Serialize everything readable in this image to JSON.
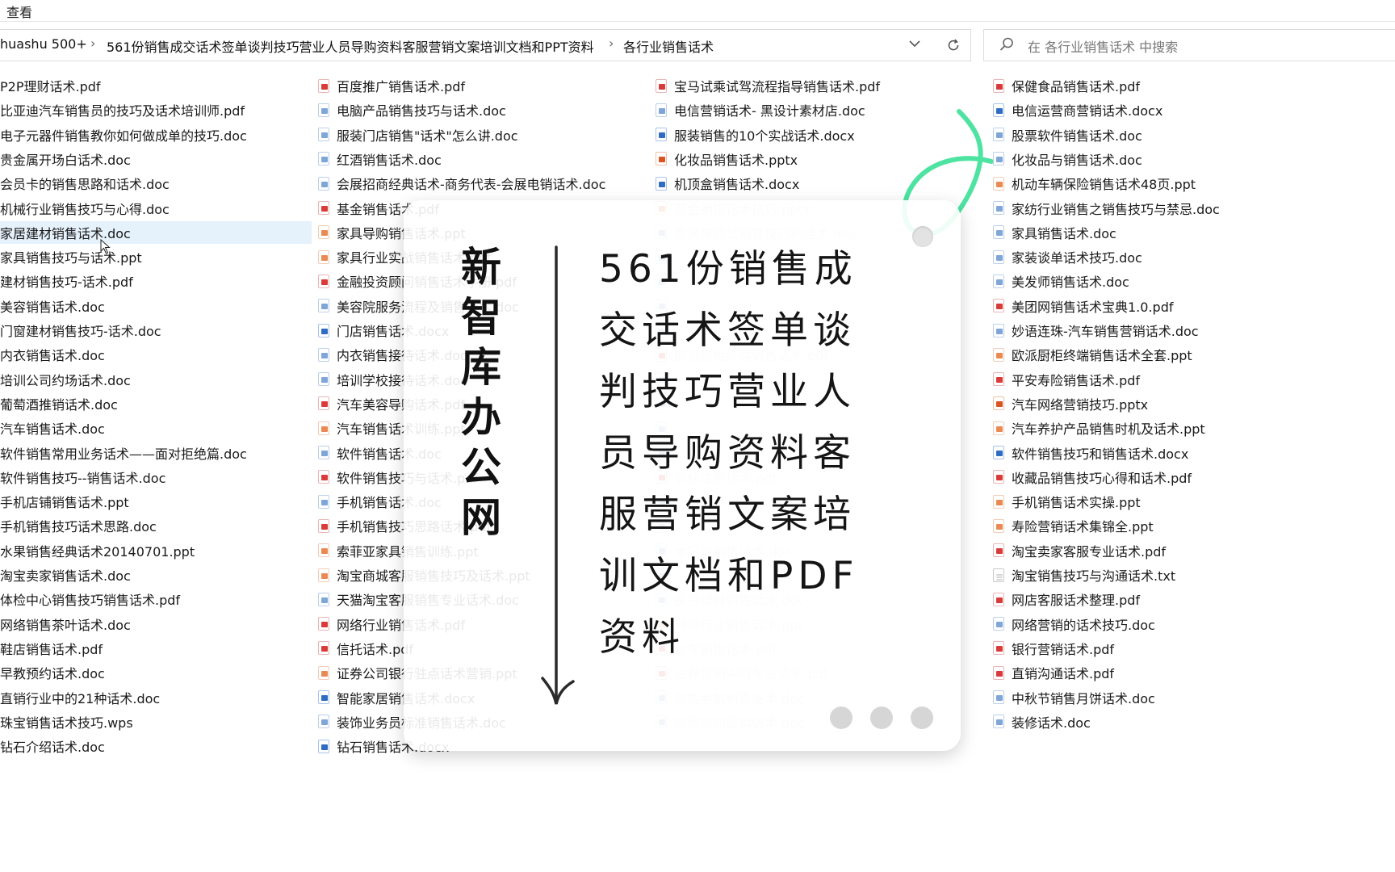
{
  "menu": {
    "view_label": "查看"
  },
  "breadcrumb": {
    "items": [
      "huashu 500+",
      "561份销售成交话术签单谈判技巧营业人员导购资料客服营销文案培训文档和PPT资料",
      "各行业销售话术"
    ]
  },
  "search": {
    "placeholder": "在 各行业销售话术 中搜索"
  },
  "columns": [
    {
      "files": [
        {
          "name": "P2P理财话术.pdf",
          "type": "none"
        },
        {
          "name": "比亚迪汽车销售员的技巧及话术培训师.pdf",
          "type": "none"
        },
        {
          "name": "电子元器件销售教你如何做成单的技巧.doc",
          "type": "none"
        },
        {
          "name": "贵金属开场白话术.doc",
          "type": "none"
        },
        {
          "name": "会员卡的销售思路和话术.doc",
          "type": "none"
        },
        {
          "name": "机械行业销售技巧与心得.doc",
          "type": "none"
        },
        {
          "name": "家居建材销售话术.doc",
          "type": "none",
          "selected": true
        },
        {
          "name": "家具销售技巧与话术.ppt",
          "type": "none"
        },
        {
          "name": "建材销售技巧-话术.pdf",
          "type": "none"
        },
        {
          "name": "美容销售话术.doc",
          "type": "none"
        },
        {
          "name": "门窗建材销售技巧-话术.doc",
          "type": "none"
        },
        {
          "name": "内衣销售话术.doc",
          "type": "none"
        },
        {
          "name": "培训公司约场话术.doc",
          "type": "none"
        },
        {
          "name": "葡萄酒推销话术.doc",
          "type": "none"
        },
        {
          "name": "汽车销售话术.doc",
          "type": "none"
        },
        {
          "name": "软件销售常用业务话术——面对拒绝篇.doc",
          "type": "none"
        },
        {
          "name": "软件销售技巧--销售话术.doc",
          "type": "none"
        },
        {
          "name": "手机店铺销售话术.ppt",
          "type": "none"
        },
        {
          "name": "手机销售技巧话术思路.doc",
          "type": "none"
        },
        {
          "name": "水果销售经典话术20140701.ppt",
          "type": "none"
        },
        {
          "name": "淘宝卖家销售话术.doc",
          "type": "none"
        },
        {
          "name": "体检中心销售技巧销售话术.pdf",
          "type": "none"
        },
        {
          "name": "网络销售茶叶话术.doc",
          "type": "none"
        },
        {
          "name": "鞋店销售话术.pdf",
          "type": "none"
        },
        {
          "name": "早教预约话术.doc",
          "type": "none"
        },
        {
          "name": "直销行业中的21种话术.doc",
          "type": "none"
        },
        {
          "name": "珠宝销售话术技巧.wps",
          "type": "none"
        },
        {
          "name": "钻石介绍话术.doc",
          "type": "none"
        }
      ]
    },
    {
      "files": [
        {
          "name": "百度推广销售话术.pdf",
          "type": "pdf"
        },
        {
          "name": "电脑产品销售技巧与话术.doc",
          "type": "doc"
        },
        {
          "name": "服装门店销售\"话术\"怎么讲.doc",
          "type": "doc"
        },
        {
          "name": "红酒销售话术.doc",
          "type": "doc"
        },
        {
          "name": "会展招商经典话术-商务代表-会展电销话术.doc",
          "type": "doc"
        },
        {
          "name": "基金销售话术.pdf",
          "type": "pdf"
        },
        {
          "name": "家具导购销售话术.ppt",
          "type": "ppt"
        },
        {
          "name": "家具行业实战销售话术.ppt",
          "type": "ppt"
        },
        {
          "name": "金融投资顾问销售话术手册.pdf",
          "type": "pdf"
        },
        {
          "name": "美容院服务流程及销售话术.doc",
          "type": "doc"
        },
        {
          "name": "门店销售话术.docx",
          "type": "docx"
        },
        {
          "name": "内衣销售接待话术.doc",
          "type": "doc"
        },
        {
          "name": "培训学校接待话术.doc",
          "type": "doc"
        },
        {
          "name": "汽车美容导购话术.pdf",
          "type": "pdf"
        },
        {
          "name": "汽车销售话术训练.ppt",
          "type": "ppt"
        },
        {
          "name": "软件销售话术.doc",
          "type": "doc"
        },
        {
          "name": "软件销售技巧与话术.pdf",
          "type": "pdf"
        },
        {
          "name": "手机销售话术.doc",
          "type": "doc"
        },
        {
          "name": "手机销售技巧思路话术.pdf",
          "type": "pdf"
        },
        {
          "name": "索菲亚家具销售训练.ppt",
          "type": "ppt"
        },
        {
          "name": "淘宝商城客服销售技巧及话术.ppt",
          "type": "ppt"
        },
        {
          "name": "天猫淘宝客服销售专业话术.doc",
          "type": "doc"
        },
        {
          "name": "网络行业销售话术.pdf",
          "type": "pdf"
        },
        {
          "name": "信托话术.pdf",
          "type": "pdf"
        },
        {
          "name": "证券公司银行驻点话术营销.ppt",
          "type": "ppt"
        },
        {
          "name": "智能家居销售话术.docx",
          "type": "docx"
        },
        {
          "name": "装饰业务员标准销售话术.doc",
          "type": "doc"
        },
        {
          "name": "钻石销售话术.docx",
          "type": "docx"
        }
      ]
    },
    {
      "files": [
        {
          "name": "宝马试乘试驾流程指导销售话术.pdf",
          "type": "pdf"
        },
        {
          "name": "电信营销话术- 黑设计素材店.doc",
          "type": "doc"
        },
        {
          "name": "服装销售的10个实战话术.docx",
          "type": "docx"
        },
        {
          "name": "化妆品销售话术.pptx",
          "type": "pptx"
        },
        {
          "name": "机顶盒销售话术.docx",
          "type": "docx"
        },
        {
          "name": "基金销售话术技巧.pptx",
          "type": "pptx"
        },
        {
          "name": "家具导购员销售技巧和话术.doc",
          "type": "doc"
        },
        {
          "name": "",
          "type": "doc"
        },
        {
          "name": "",
          "type": "doc"
        },
        {
          "name": "",
          "type": "doc"
        },
        {
          "name": "",
          "type": "doc"
        },
        {
          "name": "欧派厨柜终端销售话术.pdf",
          "type": "pdf"
        },
        {
          "name": "",
          "type": "doc"
        },
        {
          "name": "",
          "type": "doc"
        },
        {
          "name": "",
          "type": "doc"
        },
        {
          "name": "",
          "type": "doc"
        },
        {
          "name": "商标注册话术.pdf",
          "type": "pdf"
        },
        {
          "name": "",
          "type": "doc"
        },
        {
          "name": "",
          "type": "doc"
        },
        {
          "name": "太阳能销售话术.doc",
          "type": "doc"
        },
        {
          "name": "",
          "type": "doc"
        },
        {
          "name": "投资理财销售话术.doc",
          "type": "doc"
        },
        {
          "name": "网络行业销售话术.ppt",
          "type": "ppt"
        },
        {
          "name": "新车销售话术.pdf",
          "type": "pdf"
        },
        {
          "name": "证券营销中的专业话术.pdf",
          "type": "pdf"
        },
        {
          "name": "智能手机销售话术.doc",
          "type": "doc"
        },
        {
          "name": "装修公司营销话术.doc",
          "type": "doc"
        }
      ]
    },
    {
      "files": [
        {
          "name": "保健食品销售话术.pdf",
          "type": "pdf"
        },
        {
          "name": "电信运营商营销话术.docx",
          "type": "docx"
        },
        {
          "name": "股票软件销售话术.doc",
          "type": "doc"
        },
        {
          "name": "化妆品与销售话术.doc",
          "type": "doc"
        },
        {
          "name": "机动车辆保险销售话术48页.ppt",
          "type": "ppt"
        },
        {
          "name": "家纺行业销售之销售技巧与禁忌.doc",
          "type": "doc"
        },
        {
          "name": "家具销售话术.doc",
          "type": "doc"
        },
        {
          "name": "家装谈单话术技巧.doc",
          "type": "doc"
        },
        {
          "name": "美发师销售话术.doc",
          "type": "doc"
        },
        {
          "name": "美团网销售话术宝典1.0.pdf",
          "type": "pdf"
        },
        {
          "name": "妙语连珠-汽车销售营销话术.doc",
          "type": "doc"
        },
        {
          "name": "欧派厨柜终端销售话术全套.ppt",
          "type": "ppt"
        },
        {
          "name": "平安寿险销售话术.pdf",
          "type": "pdf"
        },
        {
          "name": "汽车网络营销技巧.pptx",
          "type": "pptx"
        },
        {
          "name": "汽车养护产品销售时机及话术.ppt",
          "type": "ppt"
        },
        {
          "name": "软件销售技巧和销售话术.docx",
          "type": "docx"
        },
        {
          "name": "收藏品销售技巧心得和话术.pdf",
          "type": "pdf"
        },
        {
          "name": "手机销售话术实操.ppt",
          "type": "ppt"
        },
        {
          "name": "寿险营销话术集锦全.ppt",
          "type": "ppt"
        },
        {
          "name": "淘宝卖家客服专业话术.pdf",
          "type": "pdf"
        },
        {
          "name": "淘宝销售技巧与沟通话术.txt",
          "type": "txt"
        },
        {
          "name": "网店客服话术整理.pdf",
          "type": "pdf"
        },
        {
          "name": "网络营销的话术技巧.doc",
          "type": "doc"
        },
        {
          "name": "银行营销话术.pdf",
          "type": "pdf"
        },
        {
          "name": "直销沟通话术.pdf",
          "type": "pdf"
        },
        {
          "name": "中秋节销售月饼话术.doc",
          "type": "doc"
        },
        {
          "name": "装修话术.doc",
          "type": "doc"
        }
      ]
    }
  ],
  "overlay": {
    "brand_chars": [
      "新",
      "智",
      "库",
      "办",
      "公",
      "网"
    ],
    "headline_lines": [
      "561份销售成",
      "交话术签单谈",
      "判技巧营业人",
      "员导购资料客",
      "服营销文案培",
      "训文档和PDF",
      "资料"
    ]
  },
  "colors": {
    "accent_green": "#4fe3a2",
    "pdf": "#d93b3b",
    "docx": "#2f6cc4",
    "pptx": "#d9541e",
    "selected_row": "#e5f1fb"
  }
}
